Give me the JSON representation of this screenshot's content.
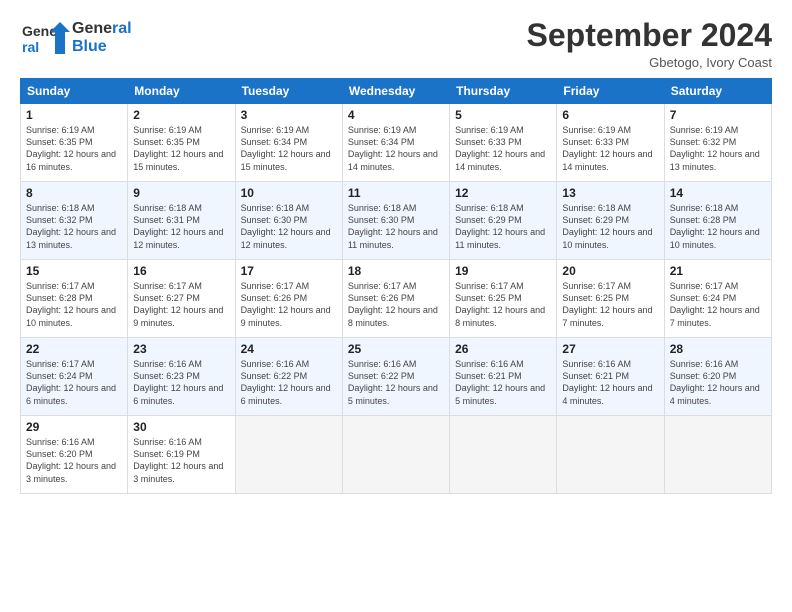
{
  "header": {
    "logo_line1": "General",
    "logo_line2": "Blue",
    "month_title": "September 2024",
    "location": "Gbetogo, Ivory Coast"
  },
  "weekdays": [
    "Sunday",
    "Monday",
    "Tuesday",
    "Wednesday",
    "Thursday",
    "Friday",
    "Saturday"
  ],
  "weeks": [
    [
      {
        "day": "1",
        "sunrise": "6:19 AM",
        "sunset": "6:35 PM",
        "daylight": "12 hours and 16 minutes."
      },
      {
        "day": "2",
        "sunrise": "6:19 AM",
        "sunset": "6:35 PM",
        "daylight": "12 hours and 15 minutes."
      },
      {
        "day": "3",
        "sunrise": "6:19 AM",
        "sunset": "6:34 PM",
        "daylight": "12 hours and 15 minutes."
      },
      {
        "day": "4",
        "sunrise": "6:19 AM",
        "sunset": "6:34 PM",
        "daylight": "12 hours and 14 minutes."
      },
      {
        "day": "5",
        "sunrise": "6:19 AM",
        "sunset": "6:33 PM",
        "daylight": "12 hours and 14 minutes."
      },
      {
        "day": "6",
        "sunrise": "6:19 AM",
        "sunset": "6:33 PM",
        "daylight": "12 hours and 14 minutes."
      },
      {
        "day": "7",
        "sunrise": "6:19 AM",
        "sunset": "6:32 PM",
        "daylight": "12 hours and 13 minutes."
      }
    ],
    [
      {
        "day": "8",
        "sunrise": "6:18 AM",
        "sunset": "6:32 PM",
        "daylight": "12 hours and 13 minutes."
      },
      {
        "day": "9",
        "sunrise": "6:18 AM",
        "sunset": "6:31 PM",
        "daylight": "12 hours and 12 minutes."
      },
      {
        "day": "10",
        "sunrise": "6:18 AM",
        "sunset": "6:30 PM",
        "daylight": "12 hours and 12 minutes."
      },
      {
        "day": "11",
        "sunrise": "6:18 AM",
        "sunset": "6:30 PM",
        "daylight": "12 hours and 11 minutes."
      },
      {
        "day": "12",
        "sunrise": "6:18 AM",
        "sunset": "6:29 PM",
        "daylight": "12 hours and 11 minutes."
      },
      {
        "day": "13",
        "sunrise": "6:18 AM",
        "sunset": "6:29 PM",
        "daylight": "12 hours and 10 minutes."
      },
      {
        "day": "14",
        "sunrise": "6:18 AM",
        "sunset": "6:28 PM",
        "daylight": "12 hours and 10 minutes."
      }
    ],
    [
      {
        "day": "15",
        "sunrise": "6:17 AM",
        "sunset": "6:28 PM",
        "daylight": "12 hours and 10 minutes."
      },
      {
        "day": "16",
        "sunrise": "6:17 AM",
        "sunset": "6:27 PM",
        "daylight": "12 hours and 9 minutes."
      },
      {
        "day": "17",
        "sunrise": "6:17 AM",
        "sunset": "6:26 PM",
        "daylight": "12 hours and 9 minutes."
      },
      {
        "day": "18",
        "sunrise": "6:17 AM",
        "sunset": "6:26 PM",
        "daylight": "12 hours and 8 minutes."
      },
      {
        "day": "19",
        "sunrise": "6:17 AM",
        "sunset": "6:25 PM",
        "daylight": "12 hours and 8 minutes."
      },
      {
        "day": "20",
        "sunrise": "6:17 AM",
        "sunset": "6:25 PM",
        "daylight": "12 hours and 7 minutes."
      },
      {
        "day": "21",
        "sunrise": "6:17 AM",
        "sunset": "6:24 PM",
        "daylight": "12 hours and 7 minutes."
      }
    ],
    [
      {
        "day": "22",
        "sunrise": "6:17 AM",
        "sunset": "6:24 PM",
        "daylight": "12 hours and 6 minutes."
      },
      {
        "day": "23",
        "sunrise": "6:16 AM",
        "sunset": "6:23 PM",
        "daylight": "12 hours and 6 minutes."
      },
      {
        "day": "24",
        "sunrise": "6:16 AM",
        "sunset": "6:22 PM",
        "daylight": "12 hours and 6 minutes."
      },
      {
        "day": "25",
        "sunrise": "6:16 AM",
        "sunset": "6:22 PM",
        "daylight": "12 hours and 5 minutes."
      },
      {
        "day": "26",
        "sunrise": "6:16 AM",
        "sunset": "6:21 PM",
        "daylight": "12 hours and 5 minutes."
      },
      {
        "day": "27",
        "sunrise": "6:16 AM",
        "sunset": "6:21 PM",
        "daylight": "12 hours and 4 minutes."
      },
      {
        "day": "28",
        "sunrise": "6:16 AM",
        "sunset": "6:20 PM",
        "daylight": "12 hours and 4 minutes."
      }
    ],
    [
      {
        "day": "29",
        "sunrise": "6:16 AM",
        "sunset": "6:20 PM",
        "daylight": "12 hours and 3 minutes."
      },
      {
        "day": "30",
        "sunrise": "6:16 AM",
        "sunset": "6:19 PM",
        "daylight": "12 hours and 3 minutes."
      },
      null,
      null,
      null,
      null,
      null
    ]
  ]
}
